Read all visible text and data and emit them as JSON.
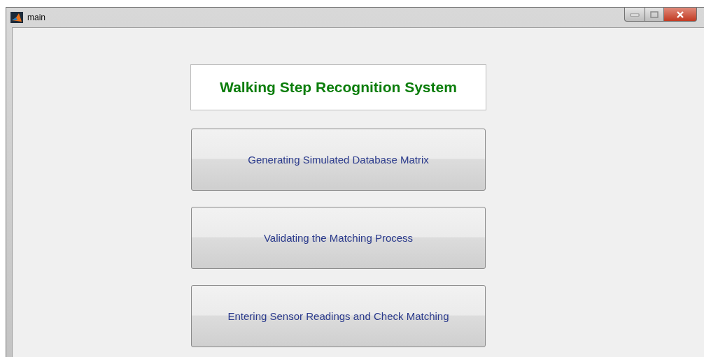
{
  "window": {
    "title": "main"
  },
  "heading": "Walking Step Recognition System",
  "buttons": [
    {
      "label": "Generating Simulated Database Matrix"
    },
    {
      "label": "Validating the Matching Process"
    },
    {
      "label": "Entering Sensor Readings and Check Matching"
    }
  ]
}
